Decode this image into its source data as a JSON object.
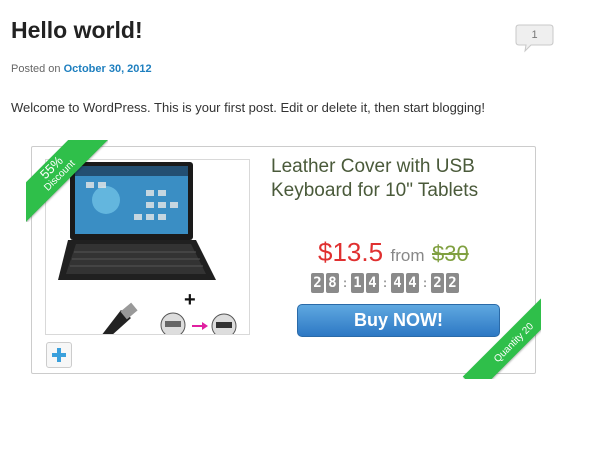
{
  "post": {
    "title": "Hello world!",
    "posted_on_label": "Posted on",
    "date": "October 30, 2012",
    "comment_count": "1",
    "content": "Welcome to WordPress. This is your first post. Edit or delete it, then start blogging!"
  },
  "deal": {
    "discount_percent": "55%",
    "discount_label": "Discount",
    "product_name": "Leather Cover with USB Keyboard for 10\" Tablets",
    "price_now": "$13.5",
    "from_label": "from",
    "price_was": "$30",
    "countdown": {
      "d1": "2",
      "d2": "8",
      "s1": ":",
      "d3": "1",
      "d4": "4",
      "s2": ":",
      "d5": "4",
      "d6": "4",
      "s3": ":",
      "d7": "2",
      "d8": "2"
    },
    "buy_label": "Buy NOW!",
    "quantity_label": "Quantity 20",
    "plus_sign": "+"
  },
  "colors": {
    "ribbon_green": "#2fbf4a",
    "price_red": "#e03030",
    "was_green": "#80a040",
    "button_blue": "#2d78c4",
    "link_blue": "#1e7fbf"
  },
  "icons": {
    "comment": "speech-bubble-icon",
    "zoom": "plus-icon"
  }
}
